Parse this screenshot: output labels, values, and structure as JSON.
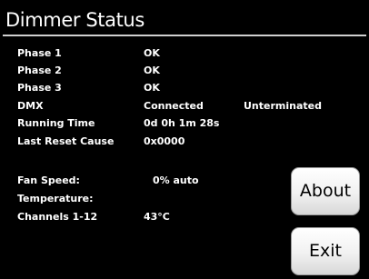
{
  "header": {
    "title": "Dimmer Status"
  },
  "status_rows": [
    {
      "label": "Phase 1",
      "value": "OK"
    },
    {
      "label": "Phase 2",
      "value": "OK"
    },
    {
      "label": "Phase 3",
      "value": "OK"
    },
    {
      "label": "DMX",
      "value": "Connected",
      "extra": "Unterminated"
    },
    {
      "label": "Running Time",
      "value": "0d 0h 1m 28s"
    },
    {
      "label": "Last Reset Cause",
      "value": "0x0000"
    }
  ],
  "fan": {
    "label": "Fan Speed:",
    "value": "0% auto"
  },
  "temperature": {
    "label": "Temperature:",
    "channel_label": "Channels 1-12",
    "channel_value": "43°C"
  },
  "buttons": {
    "about_label": "About",
    "exit_label": "Exit"
  },
  "colors": {
    "background": "#000000",
    "text": "#ffffff",
    "button_face": "#f1f1f1",
    "button_text": "#000000"
  }
}
